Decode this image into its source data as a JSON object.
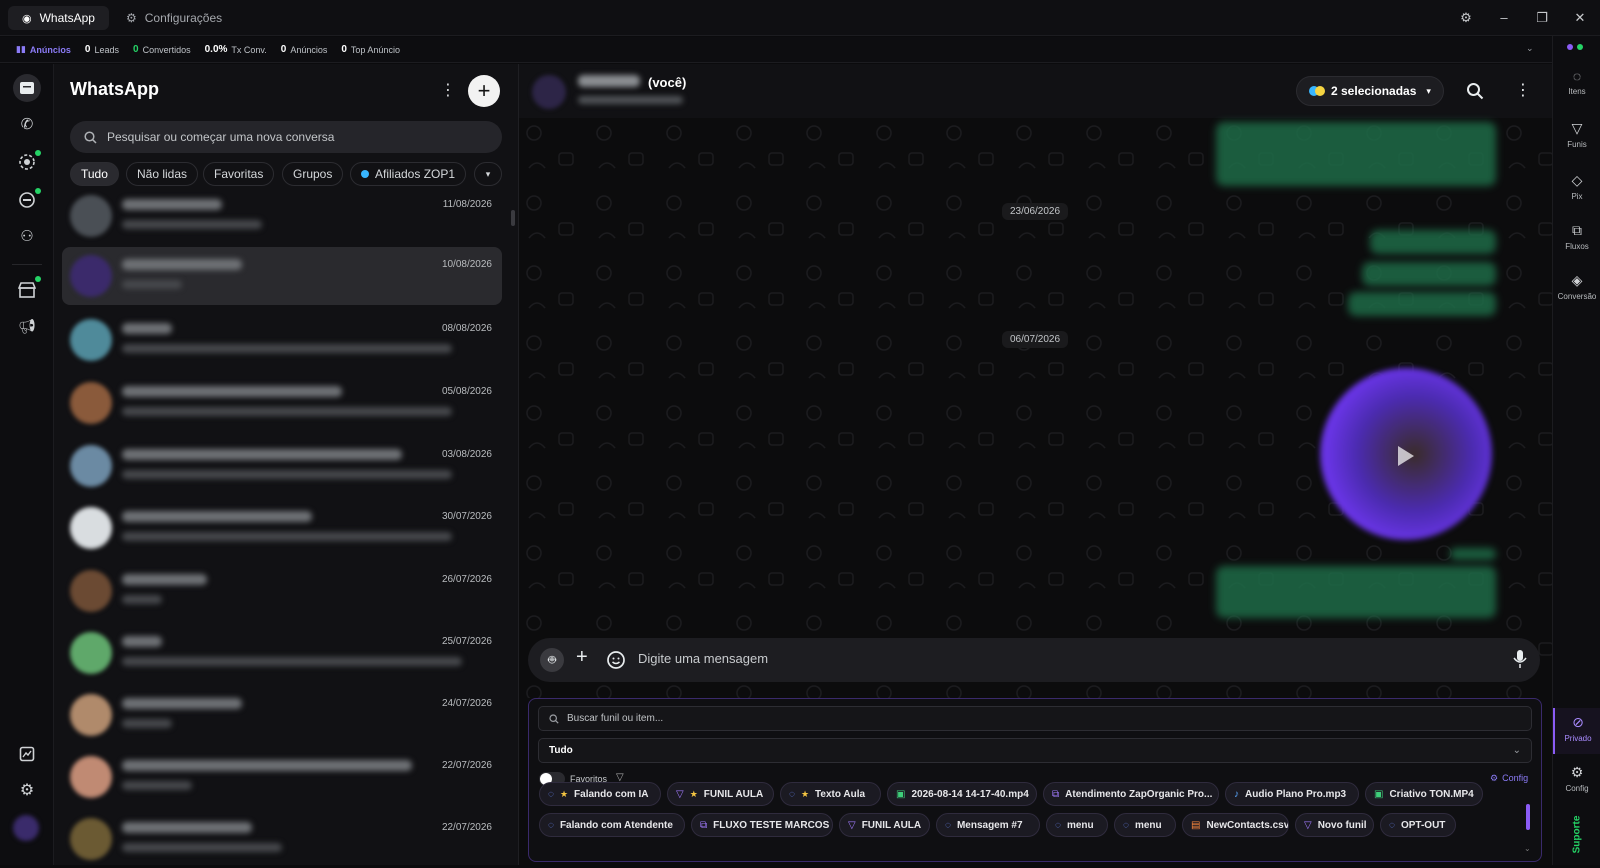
{
  "titlebar": {
    "tabs": [
      {
        "label": "WhatsApp",
        "active": true
      },
      {
        "label": "Configurações",
        "active": false
      }
    ]
  },
  "stats": {
    "ads_label": "Anúncios",
    "items": [
      {
        "value": "0",
        "label": "Leads"
      },
      {
        "value": "0",
        "label": "Convertidos"
      },
      {
        "value": "0.0%",
        "label": "Tx Conv."
      },
      {
        "value": "0",
        "label": "Anúncios"
      },
      {
        "value": "0",
        "label": "Top Anúncio"
      }
    ]
  },
  "chatlist": {
    "title": "WhatsApp",
    "search_placeholder": "Pesquisar ou começar uma nova conversa",
    "filters": [
      "Tudo",
      "Não lidas",
      "Favoritas",
      "Grupos",
      "Afiliados ZOP1"
    ],
    "dates": [
      "11/08/2026",
      "10/08/2026",
      "08/08/2026",
      "05/08/2026",
      "03/08/2026",
      "30/07/2026",
      "26/07/2026",
      "25/07/2026",
      "24/07/2026",
      "22/07/2026",
      "22/07/2026"
    ]
  },
  "conversation": {
    "contact_suffix": "(você)",
    "selected_label": "2 selecionadas",
    "date_pills": [
      "23/06/2026",
      "06/07/2026"
    ],
    "composer_placeholder": "Digite uma mensagem"
  },
  "funnel_panel": {
    "search_placeholder": "Buscar funil ou item...",
    "select_value": "Tudo",
    "favorites_label": "Favoritos",
    "config_label": "Config",
    "chips_row1": [
      {
        "label": "Falando com IA",
        "star": true,
        "icon": "message-icon"
      },
      {
        "label": "FUNIL AULA",
        "star": true,
        "icon": "funnel-icon"
      },
      {
        "label": "Texto Aula",
        "star": true,
        "icon": "message-icon"
      },
      {
        "label": "2026-08-14 14-17-40.mp4",
        "star": false,
        "icon": "video-icon"
      },
      {
        "label": "Atendimento ZapOrganic Pro...",
        "star": false,
        "icon": "flow-icon"
      },
      {
        "label": "Audio Plano Pro.mp3",
        "star": false,
        "icon": "mic-icon"
      },
      {
        "label": "Criativo TON.MP4",
        "star": false,
        "icon": "video-icon"
      }
    ],
    "chips_row2": [
      {
        "label": "Falando com Atendente",
        "icon": "message-icon"
      },
      {
        "label": "FLUXO TESTE MARCOS",
        "icon": "flow-icon"
      },
      {
        "label": "FUNIL AULA",
        "icon": "funnel-icon"
      },
      {
        "label": "Mensagem #7",
        "icon": "message-icon"
      },
      {
        "label": "menu",
        "icon": "message-icon"
      },
      {
        "label": "menu",
        "icon": "message-icon"
      },
      {
        "label": "NewContacts.csv",
        "icon": "file-icon"
      },
      {
        "label": "Novo funil",
        "icon": "funnel-icon"
      },
      {
        "label": "OPT-OUT",
        "icon": "message-icon"
      }
    ]
  },
  "rightrail": {
    "items": [
      "Itens",
      "Funis",
      "Pix",
      "Fluxos",
      "Conversão"
    ],
    "private_label": "Privado",
    "config_label": "Config",
    "support_label": "Suporte"
  },
  "colors": {
    "accent": "#8b5cf6",
    "green": "#25d366"
  }
}
